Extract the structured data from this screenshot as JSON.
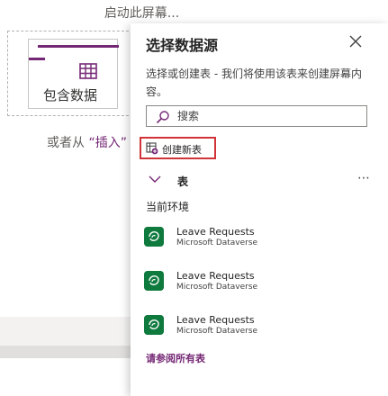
{
  "canvas": {
    "title": "启动此屏幕...",
    "card_label": "包含数据",
    "insert_hint_prefix": "或者从 ",
    "insert_link": "“插入”"
  },
  "panel": {
    "title": "选择数据源",
    "description": "选择或创建表 - 我们将使用该表来创建屏幕内容。",
    "search_placeholder": "搜索",
    "create_table_label": "创建新表",
    "section_label": "表",
    "environment_label": "当前环境",
    "sources": [
      {
        "name": "Leave Requests",
        "provider": "Microsoft Dataverse"
      },
      {
        "name": "Leave Requests",
        "provider": "Microsoft Dataverse"
      },
      {
        "name": "Leave Requests",
        "provider": "Microsoft Dataverse"
      }
    ],
    "see_all_label": "请参阅所有表"
  },
  "colors": {
    "accent": "#742774",
    "highlight": "#d13438",
    "dataverse_green": "#0f7a3e"
  }
}
